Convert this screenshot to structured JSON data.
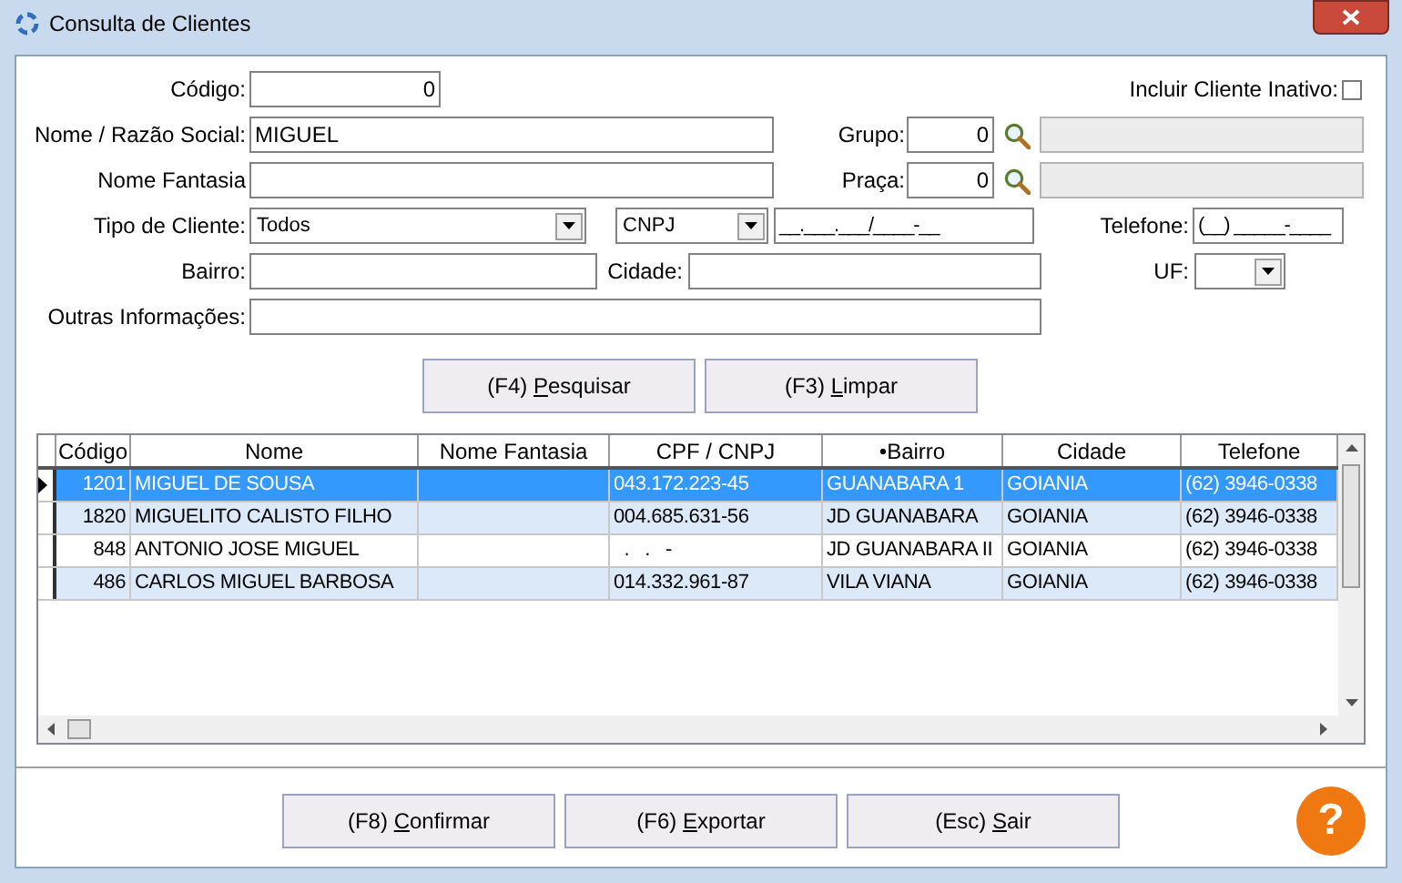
{
  "window": {
    "title": "Consulta de Clientes"
  },
  "filters": {
    "codigo": {
      "label": "Código:",
      "value": "0"
    },
    "incluir_inativo": {
      "label": "Incluir Cliente Inativo:",
      "checked": false
    },
    "nome": {
      "label": "Nome / Razão Social:",
      "value": "MIGUEL"
    },
    "grupo": {
      "label": "Grupo:",
      "value": "0"
    },
    "nome_fantasia": {
      "label": "Nome Fantasia"
    },
    "praca": {
      "label": "Praça:",
      "value": "0"
    },
    "tipo_cliente": {
      "label": "Tipo de Cliente:",
      "value": "Todos"
    },
    "documento": {
      "type_value": "CNPJ",
      "value": "__.___.___/____-__"
    },
    "telefone": {
      "label": "Telefone:",
      "value": "(__) _____-____"
    },
    "bairro": {
      "label": "Bairro:"
    },
    "cidade": {
      "label": "Cidade:"
    },
    "uf": {
      "label": "UF:"
    },
    "outras": {
      "label": "Outras Informações:"
    }
  },
  "search_buttons": [
    {
      "label": "(F4) Pesquisar"
    },
    {
      "label": "(F3) Limpar"
    }
  ],
  "table": {
    "columns": [
      "Código",
      "Nome",
      "Nome Fantasia",
      "CPF / CNPJ",
      "•Bairro",
      "Cidade",
      "Telefone"
    ],
    "rows": [
      {
        "selected": true,
        "cells": [
          "1201",
          "MIGUEL DE SOUSA",
          "",
          "043.172.223-45",
          "GUANABARA 1",
          "GOIANIA",
          "(62) 3946-0338"
        ]
      },
      {
        "selected": false,
        "cells": [
          "1820",
          "MIGUELITO CALISTO FILHO",
          "",
          "004.685.631-56",
          "JD GUANABARA",
          "GOIANIA",
          "(62) 3946-0338"
        ]
      },
      {
        "selected": false,
        "cells": [
          "848",
          "ANTONIO JOSE MIGUEL",
          "",
          "  .   .   -",
          "JD GUANABARA II",
          "GOIANIA",
          "(62) 3946-0338"
        ]
      },
      {
        "selected": false,
        "cells": [
          "486",
          "CARLOS MIGUEL BARBOSA",
          "",
          "014.332.961-87",
          "VILA VIANA",
          "GOIANIA",
          "(62) 3946-0338"
        ]
      }
    ]
  },
  "footer_buttons": [
    {
      "label": "(F8) Confirmar"
    },
    {
      "label": "(F6) Exportar"
    },
    {
      "label": "(Esc) Sair"
    }
  ],
  "help_button": {
    "label": "?"
  }
}
